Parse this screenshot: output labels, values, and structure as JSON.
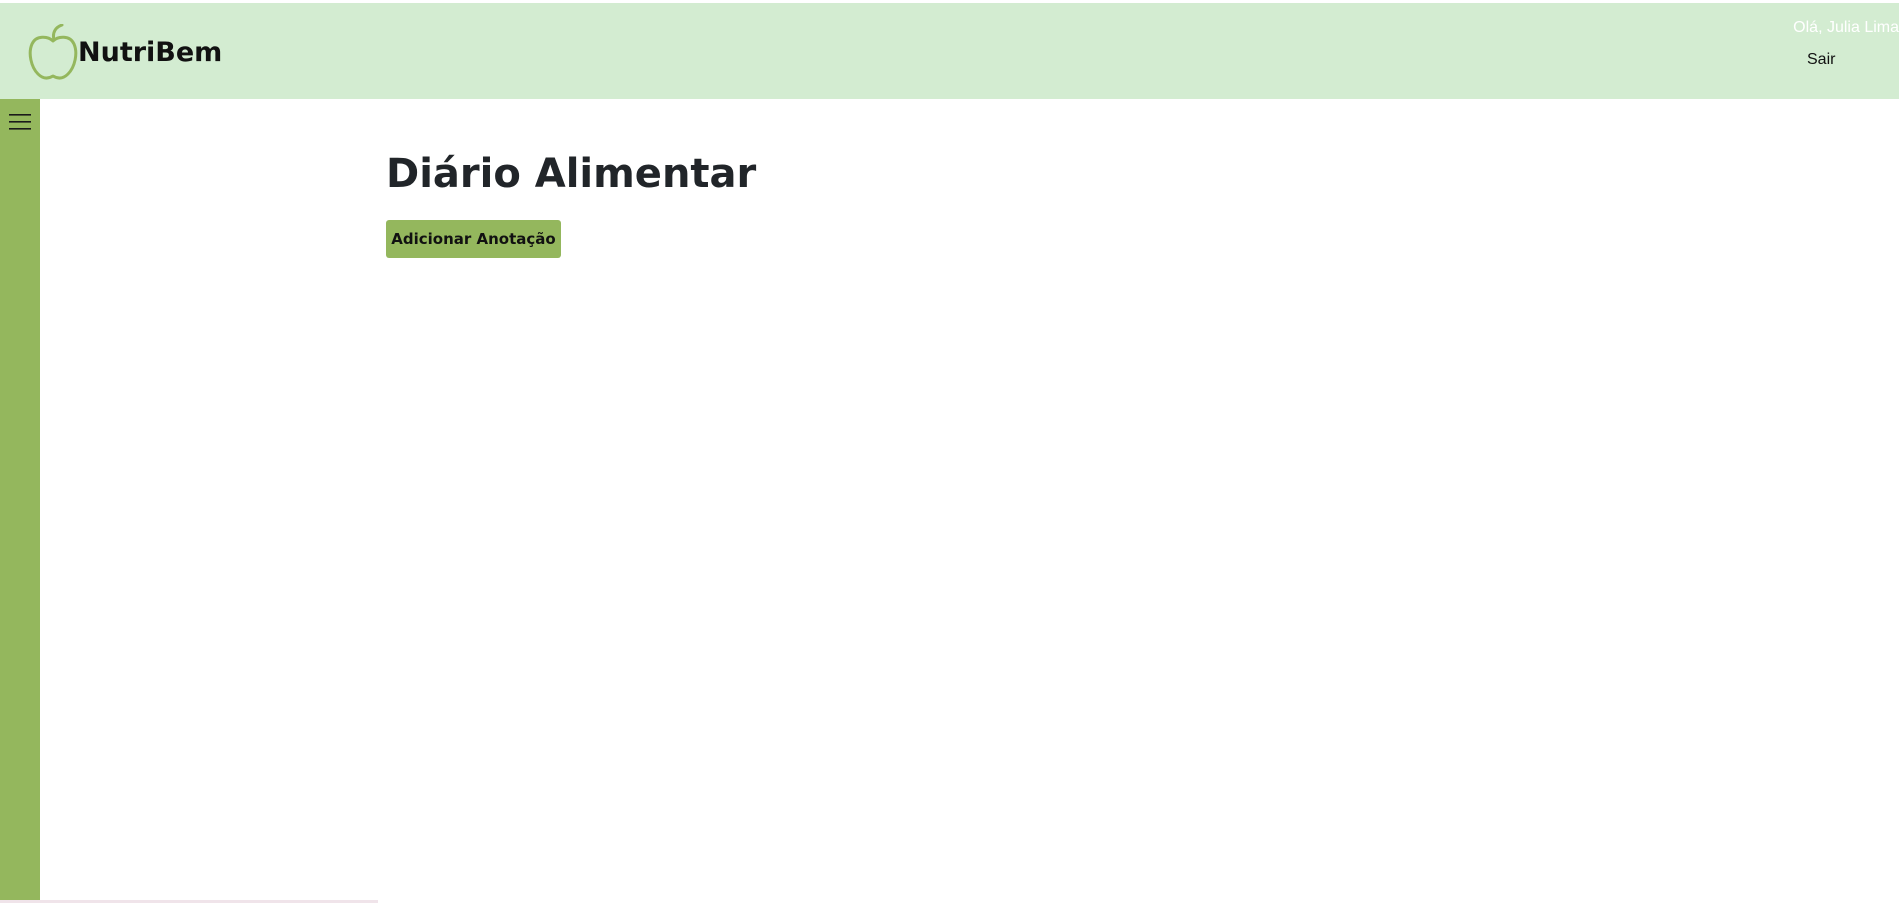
{
  "app": {
    "brand_name": "NutriBem",
    "logo_icon": "apple-outline-icon"
  },
  "header": {
    "greeting": "Olá, Julia Lima",
    "logout_label": "Sair"
  },
  "sidebar": {
    "toggle_icon": "hamburger-menu-icon"
  },
  "main": {
    "title": "Diário Alimentar",
    "add_button_label": "Adicionar Anotação"
  },
  "colors": {
    "header_bg": "#d3ecd1",
    "sidebar_bg": "#94b75d",
    "accent": "#94b75d",
    "title_text": "#212529"
  }
}
